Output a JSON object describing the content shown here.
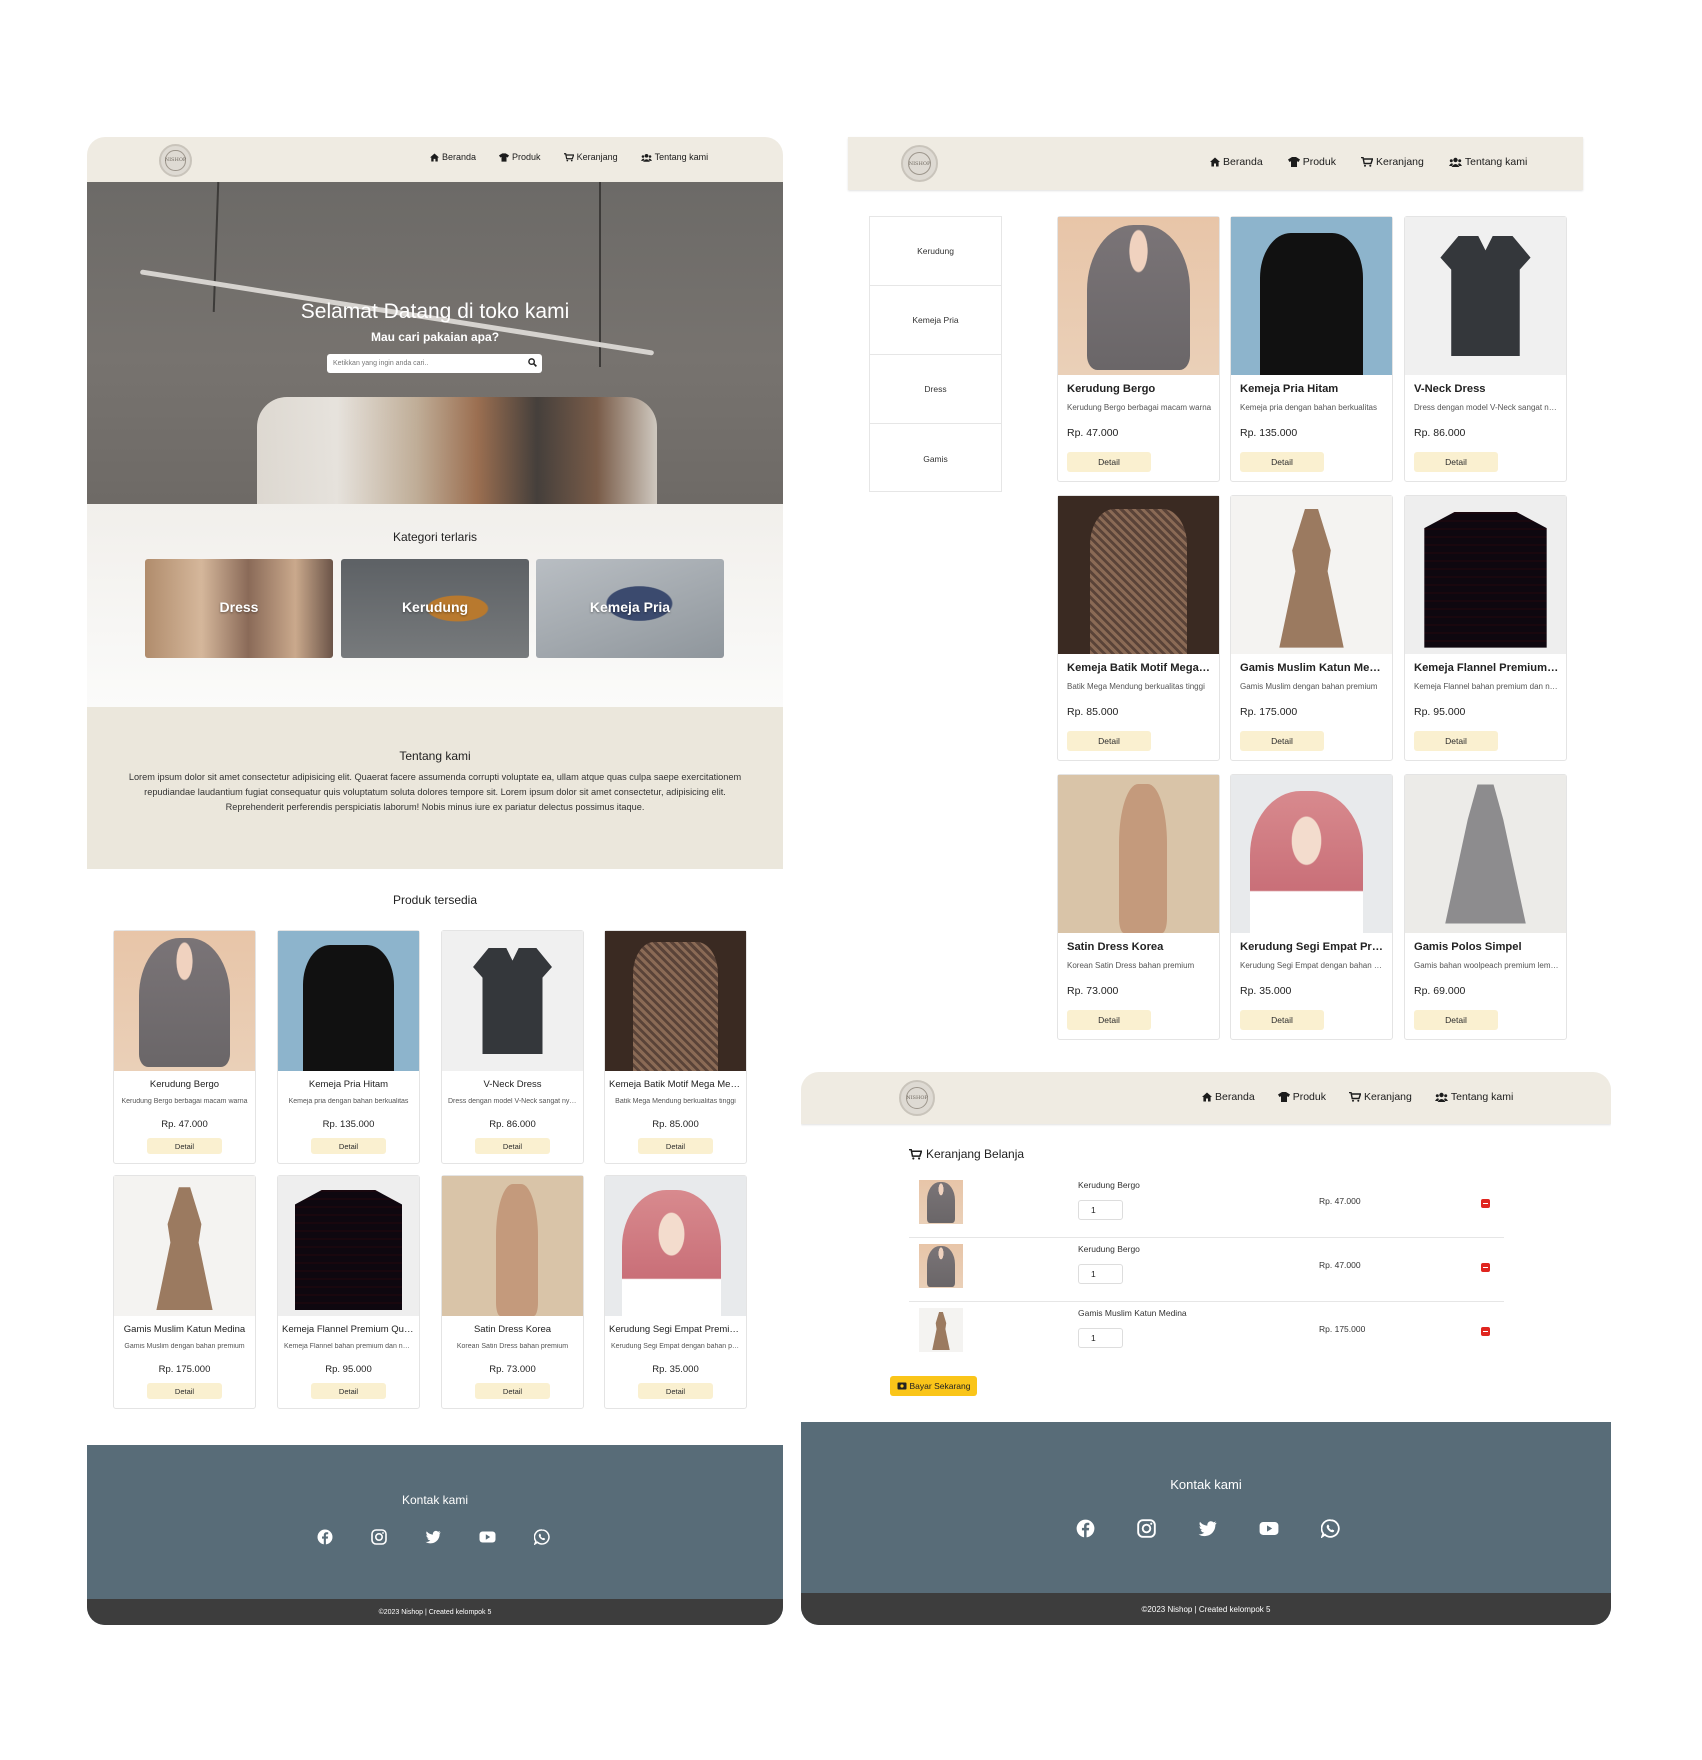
{
  "nav": {
    "items": [
      {
        "label": "Beranda",
        "icon": "home-icon"
      },
      {
        "label": "Produk",
        "icon": "shirt-icon"
      },
      {
        "label": "Keranjang",
        "icon": "cart-icon"
      },
      {
        "label": "Tentang kami",
        "icon": "users-icon"
      }
    ],
    "logo_text": "NISHOP"
  },
  "hero": {
    "title": "Selamat Datang di toko kami",
    "subtitle": "Mau cari pakaian apa?",
    "search_placeholder": "Ketikkan yang ingin anda cari.."
  },
  "categories": {
    "title": "Kategori terlaris",
    "items": [
      "Dress",
      "Kerudung",
      "Kemeja Pria"
    ]
  },
  "about": {
    "title": "Tentang kami",
    "text": "Lorem ipsum dolor sit amet consectetur adipisicing elit. Quaerat facere assumenda corrupti voluptate ea, ullam atque quas culpa saepe exercitationem repudiandae laudantium fugiat consequatur quis voluptatum soluta dolores tempore sit. Lorem ipsum dolor sit amet consectetur, adipisicing elit. Reprehenderit perferendis perspiciatis laborum! Nobis minus iure ex pariatur delectus possimus itaque."
  },
  "produk_title": "Produk tersedia",
  "detail_label": "Detail",
  "products": [
    {
      "name": "Kerudung Bergo",
      "desc": "Kerudung Bergo berbagai macam warna",
      "price": "Rp. 47.000"
    },
    {
      "name": "Kemeja Pria Hitam",
      "desc": "Kemeja pria dengan bahan berkualitas",
      "price": "Rp. 135.000"
    },
    {
      "name": "V-Neck Dress",
      "desc": "Dress dengan model V-Neck sangat nyaman",
      "price": "Rp. 86.000"
    },
    {
      "name": "Kemeja Batik Motif Mega Mendung",
      "desc": "Batik Mega Mendung berkualitas tinggi",
      "price": "Rp. 85.000"
    },
    {
      "name": "Gamis Muslim Katun Medina",
      "desc": "Gamis Muslim dengan bahan premium",
      "price": "Rp. 175.000"
    },
    {
      "name": "Kemeja Flannel Premium Quality",
      "desc": "Kemeja Flannel bahan premium dan nyaman",
      "price": "Rp. 95.000"
    },
    {
      "name": "Satin Dress Korea",
      "desc": "Korean Satin Dress bahan premium",
      "price": "Rp. 73.000"
    },
    {
      "name": "Kerudung Segi Empat Premium",
      "desc": "Kerudung Segi Empat dengan bahan premium",
      "price": "Rp. 35.000"
    },
    {
      "name": "Gamis Polos Simpel",
      "desc": "Gamis bahan woolpeach premium lembut",
      "price": "Rp. 69.000"
    }
  ],
  "sidebar": {
    "items": [
      "Kerudung",
      "Kemeja Pria",
      "Dress",
      "Gamis"
    ]
  },
  "cart": {
    "title": "Keranjang Belanja",
    "items": [
      {
        "name": "Kerudung Bergo",
        "qty": "1",
        "price": "Rp. 47.000"
      },
      {
        "name": "Kerudung Bergo",
        "qty": "1",
        "price": "Rp. 47.000"
      },
      {
        "name": "Gamis Muslim Katun Medina",
        "qty": "1",
        "price": "Rp. 175.000"
      }
    ],
    "pay_label": "Bayar Sekarang"
  },
  "footer": {
    "title": "Kontak kami",
    "social": [
      "facebook-icon",
      "instagram-icon",
      "twitter-icon",
      "youtube-icon",
      "whatsapp-icon"
    ],
    "copyright": "©2023 Nishop | Created kelompok 5"
  },
  "colors": {
    "nav_bg": "#efebe2",
    "about_bg": "#ebe7dc",
    "footer_bg": "#586c78",
    "copyright_bg": "#3d3d3d",
    "detail_btn": "#faf0d0",
    "pay_btn": "#fac519",
    "delete_btn": "#e0251f"
  }
}
